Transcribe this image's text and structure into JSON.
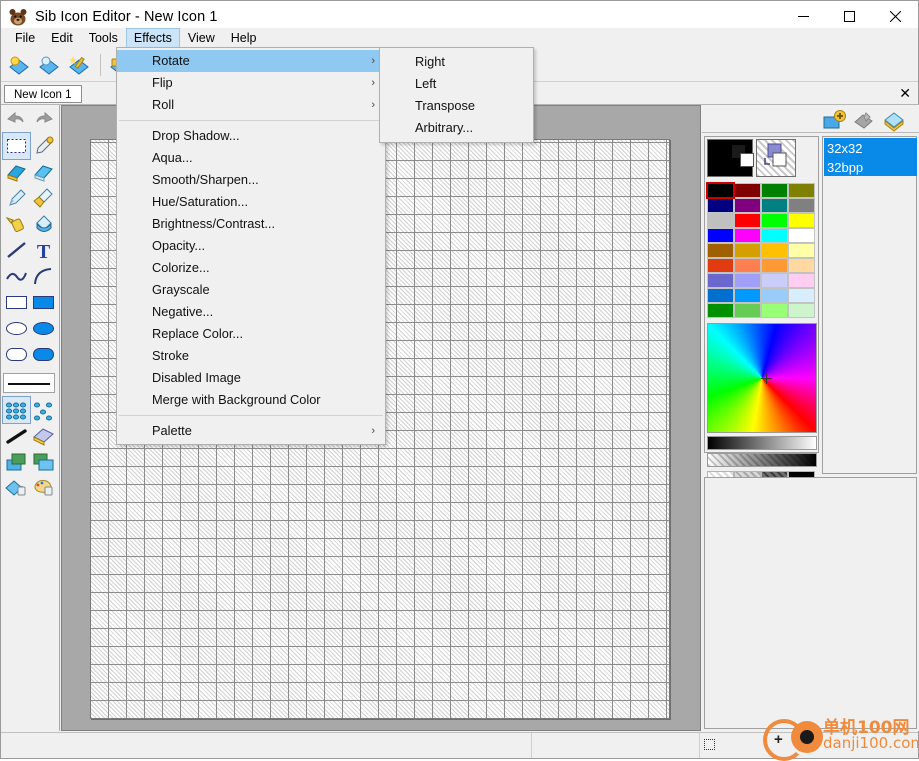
{
  "window": {
    "title": "Sib Icon Editor - New Icon 1",
    "app_icon": "bear-icon",
    "minimize": "—",
    "maximize": "☐",
    "close": "✕"
  },
  "menubar": {
    "items": [
      {
        "label": "File",
        "active": false
      },
      {
        "label": "Edit",
        "active": false
      },
      {
        "label": "Tools",
        "active": false
      },
      {
        "label": "Effects",
        "active": true
      },
      {
        "label": "View",
        "active": false
      },
      {
        "label": "Help",
        "active": false
      }
    ]
  },
  "toolbar": {
    "buttons": [
      {
        "name": "new-icon-button",
        "glyph": "✦"
      },
      {
        "name": "open-icon-button",
        "glyph": "◆"
      },
      {
        "name": "effects-wizard-button",
        "glyph": "✨"
      },
      {
        "name": "save-button",
        "glyph": "▣"
      }
    ],
    "combo_value": "",
    "combo_arrow": "⌄"
  },
  "tabs": {
    "items": [
      {
        "label": "New Icon 1",
        "active": true
      }
    ],
    "close_label": "✕"
  },
  "tools": {
    "undo_label": "↶",
    "redo_label": "↷",
    "items": [
      {
        "name": "select-rectangle-tool"
      },
      {
        "name": "color-picker-tool"
      },
      {
        "name": "eraser-tool"
      },
      {
        "name": "eraser-transparent-tool"
      },
      {
        "name": "pencil-tool"
      },
      {
        "name": "brush-tool"
      },
      {
        "name": "airbrush-tool"
      },
      {
        "name": "paint-bucket-tool"
      },
      {
        "name": "line-tool"
      },
      {
        "name": "text-tool"
      },
      {
        "name": "curve-tool"
      },
      {
        "name": "arc-tool"
      },
      {
        "name": "rectangle-outline-tool"
      },
      {
        "name": "rectangle-filled-tool"
      },
      {
        "name": "ellipse-outline-tool"
      },
      {
        "name": "ellipse-filled-tool"
      },
      {
        "name": "rounded-rect-outline-tool"
      },
      {
        "name": "rounded-rect-filled-tool"
      },
      {
        "name": "gradient-tool"
      },
      {
        "name": "scatter-tool"
      },
      {
        "name": "smudge-tool"
      },
      {
        "name": "sharpen-tool"
      },
      {
        "name": "layer-merge-tool"
      },
      {
        "name": "layer-copy-tool"
      },
      {
        "name": "lock-transparency-tool"
      },
      {
        "name": "lock-palette-tool"
      }
    ]
  },
  "canvas": {
    "size_label": "32x32",
    "grid_visible": true
  },
  "right_panel": {
    "toolbar_buttons": [
      {
        "name": "add-image-button"
      },
      {
        "name": "delete-image-button"
      },
      {
        "name": "image-properties-button"
      }
    ],
    "foreground_color": "#000000",
    "background_color": "transparent",
    "selected_swatch_index": 0,
    "palette_rows": [
      [
        "#000000",
        "#800000",
        "#008000",
        "#808000"
      ],
      [
        "#000080",
        "#800080",
        "#008080",
        "#808080"
      ],
      [
        "#c0c0c0",
        "#ff0000",
        "#00ff00",
        "#ffff00"
      ],
      [
        "#0000ff",
        "#ff00ff",
        "#00ffff",
        "#ffffff"
      ],
      [
        "#a06000",
        "#d4a000",
        "#ffc000",
        "#ffffa8"
      ],
      [
        "#e03c10",
        "#ff7f50",
        "#ff9933",
        "#ffd9a0"
      ],
      [
        "#6a68cc",
        "#a0a0f8",
        "#ccccf8",
        "#ffccf2"
      ],
      [
        "#0070d0",
        "#0099ff",
        "#99ccf8",
        "#d8eeff"
      ],
      [
        "#009000",
        "#66cc55",
        "#99ff77",
        "#ccf5cc"
      ]
    ],
    "alpha_swatches": [
      "#ffffff",
      "#b9b9b9",
      "#5c5c5c",
      "#000000"
    ],
    "layers": [
      {
        "size": "32x32",
        "depth": "32bpp",
        "selected": true
      }
    ]
  },
  "menus": {
    "effects": {
      "items": [
        {
          "label": "Rotate",
          "submenu": true,
          "highlighted": true,
          "arrow": "›"
        },
        {
          "label": "Flip",
          "submenu": true,
          "highlighted": false,
          "arrow": "›"
        },
        {
          "label": "Roll",
          "submenu": true,
          "highlighted": false,
          "arrow": "›"
        },
        {
          "separator": true
        },
        {
          "label": "Drop Shadow...",
          "submenu": false,
          "highlighted": false
        },
        {
          "label": "Aqua...",
          "submenu": false,
          "highlighted": false
        },
        {
          "label": "Smooth/Sharpen...",
          "submenu": false,
          "highlighted": false
        },
        {
          "label": "Hue/Saturation...",
          "submenu": false,
          "highlighted": false
        },
        {
          "label": "Brightness/Contrast...",
          "submenu": false,
          "highlighted": false
        },
        {
          "label": "Opacity...",
          "submenu": false,
          "highlighted": false
        },
        {
          "label": "Colorize...",
          "submenu": false,
          "highlighted": false
        },
        {
          "label": "Grayscale",
          "submenu": false,
          "highlighted": false
        },
        {
          "label": "Negative...",
          "submenu": false,
          "highlighted": false
        },
        {
          "label": "Replace Color...",
          "submenu": false,
          "highlighted": false
        },
        {
          "label": "Stroke",
          "submenu": false,
          "highlighted": false
        },
        {
          "label": "Disabled Image",
          "submenu": false,
          "highlighted": false
        },
        {
          "label": "Merge with Background Color",
          "submenu": false,
          "highlighted": false
        },
        {
          "separator": true
        },
        {
          "label": "Palette",
          "submenu": true,
          "highlighted": false,
          "arrow": "›"
        }
      ]
    },
    "rotate_submenu": {
      "items": [
        {
          "label": "Right"
        },
        {
          "label": "Left"
        },
        {
          "label": "Transpose"
        },
        {
          "label": "Arbitrary..."
        }
      ]
    }
  },
  "watermark": {
    "chinese": "单机100网",
    "domain": "danji100.com"
  }
}
